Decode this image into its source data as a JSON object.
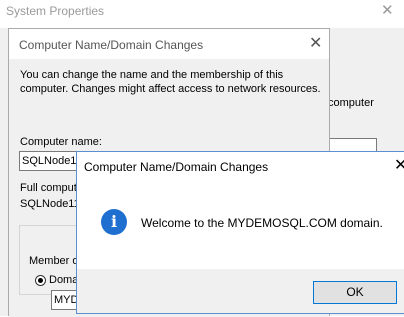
{
  "system_properties": {
    "title": "System Properties",
    "close_glyph": "✕",
    "side_text": "computer"
  },
  "name_changes_dialog": {
    "title": "Computer Name/Domain Changes",
    "close_glyph": "✕",
    "description_line1": "You can change the name and the membership of this",
    "description_line2": "computer. Changes might affect access to network resources.",
    "computer_name_label": "Computer name:",
    "computer_name_value": "SQLNode1",
    "full_name_label": "Full compute",
    "full_name_value": "SQLNode11",
    "member_of_label": "Member o",
    "domain_label": "Doma",
    "domain_value": "MYD",
    "domain_selected": true
  },
  "message_box": {
    "title": "Computer Name/Domain Changes",
    "close_glyph": "✕",
    "icon": "info-icon",
    "icon_glyph": "i",
    "message": "Welcome to the MYDEMOSQL.COM domain.",
    "ok_label": "OK",
    "accent_color": "#1e6fd0"
  }
}
